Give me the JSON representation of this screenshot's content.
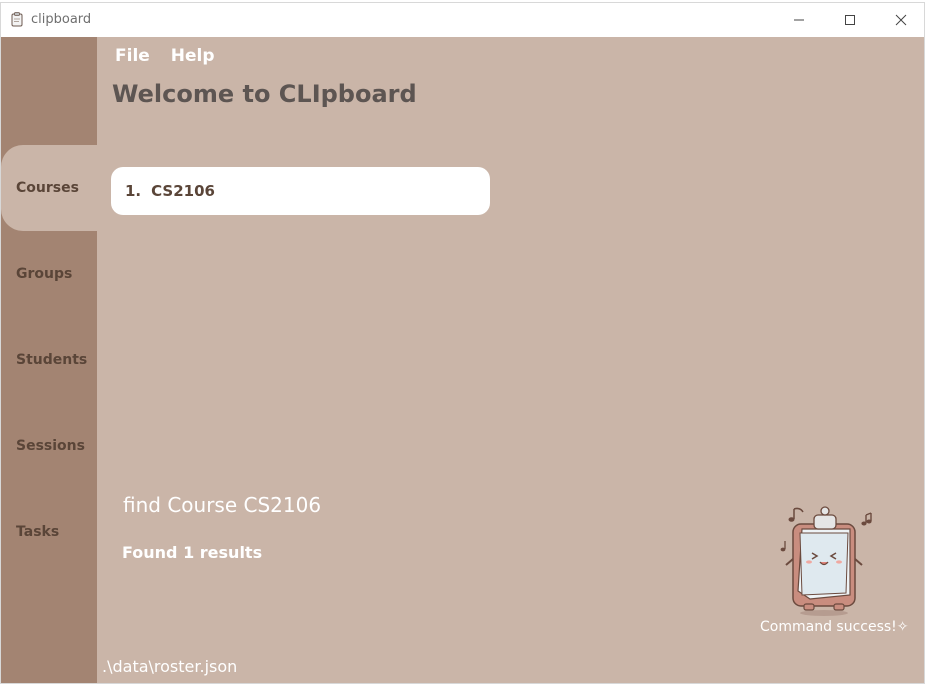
{
  "window": {
    "title": "clipboard",
    "minimize_icon": "minimize-icon",
    "maximize_icon": "maximize-icon",
    "close_icon": "close-icon"
  },
  "menu": {
    "file": "File",
    "help": "Help"
  },
  "header": {
    "title": "Welcome to CLIpboard"
  },
  "sidebar": {
    "items": [
      {
        "label": "Courses",
        "active": true
      },
      {
        "label": "Groups",
        "active": false
      },
      {
        "label": "Students",
        "active": false
      },
      {
        "label": "Sessions",
        "active": false
      },
      {
        "label": "Tasks",
        "active": false
      }
    ]
  },
  "courses": [
    {
      "index": "1.",
      "code": "CS2106"
    }
  ],
  "command": {
    "text": "find Course CS2106"
  },
  "result": {
    "text": "Found 1 results"
  },
  "mascot": {
    "caption": "Command success!✧"
  },
  "status": {
    "path": ".\\data\\roster.json"
  },
  "colors": {
    "content_bg": "#cab5a8",
    "sidebar_bg": "#a38472",
    "text_dark": "#5a4538",
    "card_bg": "#ffffff"
  }
}
